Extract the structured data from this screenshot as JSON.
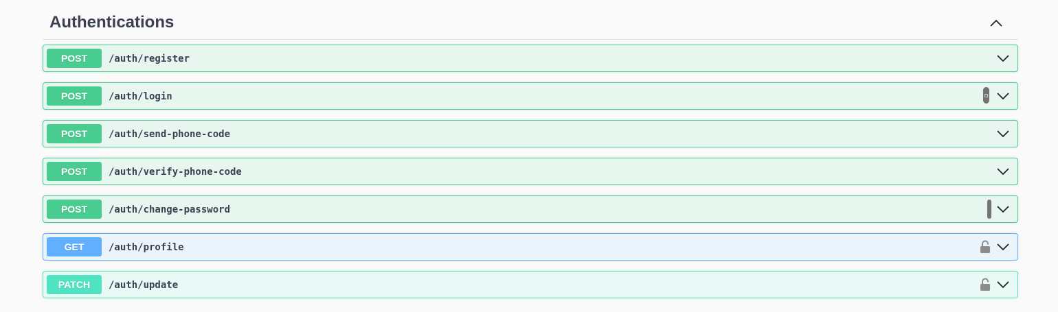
{
  "section": {
    "title": "Authentications",
    "collapse_icon": "chevron-up-icon"
  },
  "operations": [
    {
      "method": "POST",
      "path": "/auth/register",
      "lock": "none"
    },
    {
      "method": "POST",
      "path": "/auth/login",
      "lock": "pill"
    },
    {
      "method": "POST",
      "path": "/auth/send-phone-code",
      "lock": "none"
    },
    {
      "method": "POST",
      "path": "/auth/verify-phone-code",
      "lock": "none"
    },
    {
      "method": "POST",
      "path": "/auth/change-password",
      "lock": "pill-thin"
    },
    {
      "method": "GET",
      "path": "/auth/profile",
      "lock": "unlocked"
    },
    {
      "method": "PATCH",
      "path": "/auth/update",
      "lock": "unlocked"
    }
  ],
  "colors": {
    "post": "#49cc90",
    "get": "#61affe",
    "patch": "#50e3c2",
    "text": "#3b4151"
  },
  "icons": {
    "expand": "chevron-down-icon",
    "lock": "unlock-icon"
  }
}
